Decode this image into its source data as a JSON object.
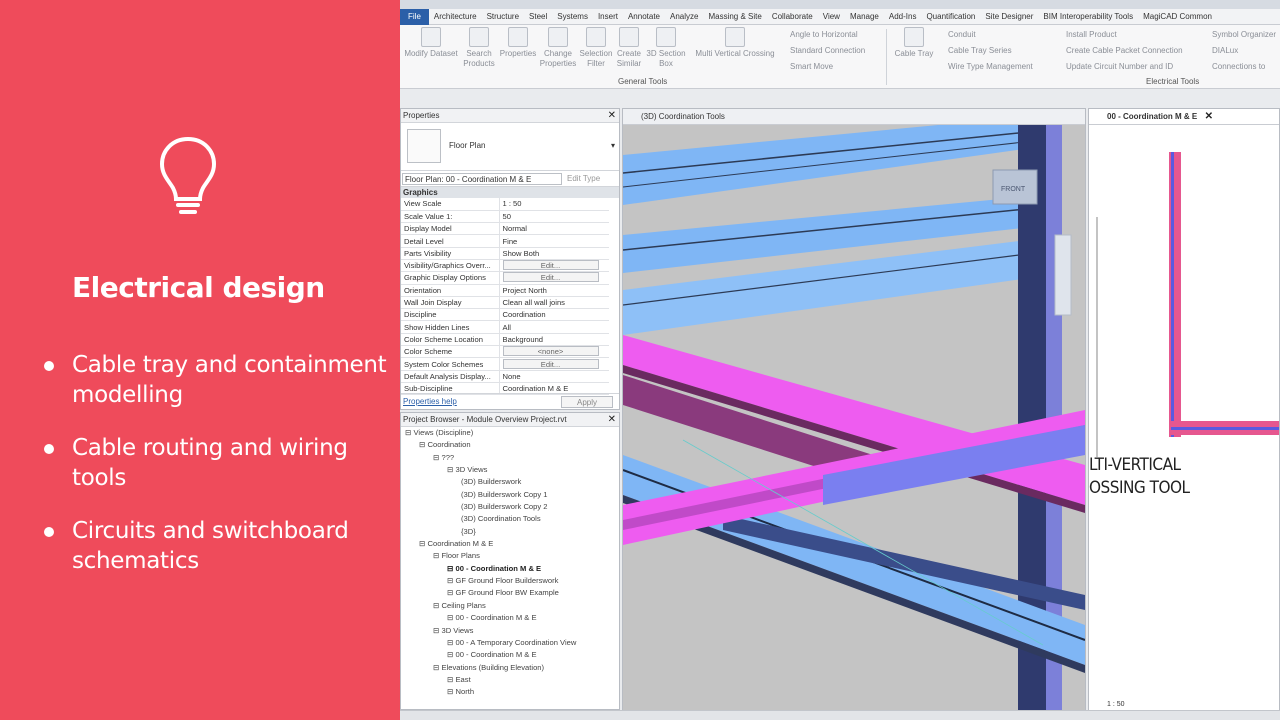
{
  "slide": {
    "icon": "lightbulb-icon",
    "title": "Electrical design",
    "bullets": [
      "Cable tray and containment modelling",
      "Cable routing and wiring tools",
      "Circuits and switchboard schematics"
    ],
    "background": "#ef4b5b"
  },
  "menu": [
    "File",
    "Architecture",
    "Structure",
    "Steel",
    "Systems",
    "Insert",
    "Annotate",
    "Analyze",
    "Massing & Site",
    "Collaborate",
    "View",
    "Manage",
    "Add-Ins",
    "Quantification",
    "Site Designer",
    "BIM Interoperability Tools",
    "MagiCAD Common"
  ],
  "ribbon": {
    "general_tools": [
      "Modify Dataset",
      "Search Products",
      "Properties",
      "Change Properties",
      "Selection Filter",
      "Create Similar",
      "3D Section Box",
      "Multi Vertical Crossing"
    ],
    "general_small": [
      "Angle to Horizontal",
      "Standard Connection",
      "Smart Move"
    ],
    "general_group": "General Tools",
    "cable_tray": "Cable Tray",
    "electrical_small": [
      "Conduit",
      "Cable Tray Series",
      "Wire Type Management"
    ],
    "electrical_small2": [
      "Install Product",
      "Create Cable Packet Connection",
      "Update Circuit Number and ID"
    ],
    "electrical_small3": [
      "Symbol Organizer",
      "DIALux",
      "Connections to"
    ],
    "electrical_group": "Electrical Tools"
  },
  "properties": {
    "title": "Properties",
    "type_name": "Floor Plan",
    "selector": "Floor Plan: 00 - Coordination M & E",
    "edit_type": "Edit Type",
    "group": "Graphics",
    "rows": [
      {
        "k": "View Scale",
        "v": "1 : 50"
      },
      {
        "k": "Scale Value    1:",
        "v": "50"
      },
      {
        "k": "Display Model",
        "v": "Normal"
      },
      {
        "k": "Detail Level",
        "v": "Fine"
      },
      {
        "k": "Parts Visibility",
        "v": "Show Both"
      },
      {
        "k": "Visibility/Graphics Overr...",
        "v": "Edit..."
      },
      {
        "k": "Graphic Display Options",
        "v": "Edit..."
      },
      {
        "k": "Orientation",
        "v": "Project North"
      },
      {
        "k": "Wall Join Display",
        "v": "Clean all wall joins"
      },
      {
        "k": "Discipline",
        "v": "Coordination"
      },
      {
        "k": "Show Hidden Lines",
        "v": "All"
      },
      {
        "k": "Color Scheme Location",
        "v": "Background"
      },
      {
        "k": "Color Scheme",
        "v": "<none>"
      },
      {
        "k": "System Color Schemes",
        "v": "Edit..."
      },
      {
        "k": "Default Analysis Display...",
        "v": "None"
      },
      {
        "k": "Sub-Discipline",
        "v": "Coordination M & E"
      }
    ],
    "help": "Properties help",
    "apply": "Apply"
  },
  "browser": {
    "title": "Project Browser - Module Overview Project.rvt",
    "nodes": [
      {
        "t": "Views (Discipline)",
        "d": 0
      },
      {
        "t": "Coordination",
        "d": 1
      },
      {
        "t": "???",
        "d": 2
      },
      {
        "t": "3D Views",
        "d": 3
      },
      {
        "t": "(3D) Builderswork",
        "d": 4
      },
      {
        "t": "(3D) Builderswork Copy 1",
        "d": 4
      },
      {
        "t": "(3D) Builderswork Copy 2",
        "d": 4
      },
      {
        "t": "(3D) Coordination Tools",
        "d": 4
      },
      {
        "t": "{3D}",
        "d": 4
      },
      {
        "t": "Coordination M & E",
        "d": 1
      },
      {
        "t": "Floor Plans",
        "d": 2
      },
      {
        "t": "00 - Coordination M & E",
        "d": 3,
        "b": true
      },
      {
        "t": "GF Ground Floor Builderswork",
        "d": 3
      },
      {
        "t": "GF Ground Floor BW Example",
        "d": 3
      },
      {
        "t": "Ceiling Plans",
        "d": 2
      },
      {
        "t": "00 - Coordination M & E",
        "d": 3
      },
      {
        "t": "3D Views",
        "d": 2
      },
      {
        "t": "00 - A Temporary Coordination View",
        "d": 3
      },
      {
        "t": "00 - Coordination M & E",
        "d": 3
      },
      {
        "t": "Elevations (Building Elevation)",
        "d": 2
      },
      {
        "t": "East",
        "d": 3
      },
      {
        "t": "North",
        "d": 3
      }
    ]
  },
  "view3d": {
    "tab": "(3D) Coordination Tools",
    "cube_label": "FRONT"
  },
  "plan": {
    "tab": "00 - Coordination M & E",
    "overlay_line1": "LTI-VERTICAL",
    "overlay_line2": "OSSING TOOL",
    "scale": "1 : 50"
  }
}
